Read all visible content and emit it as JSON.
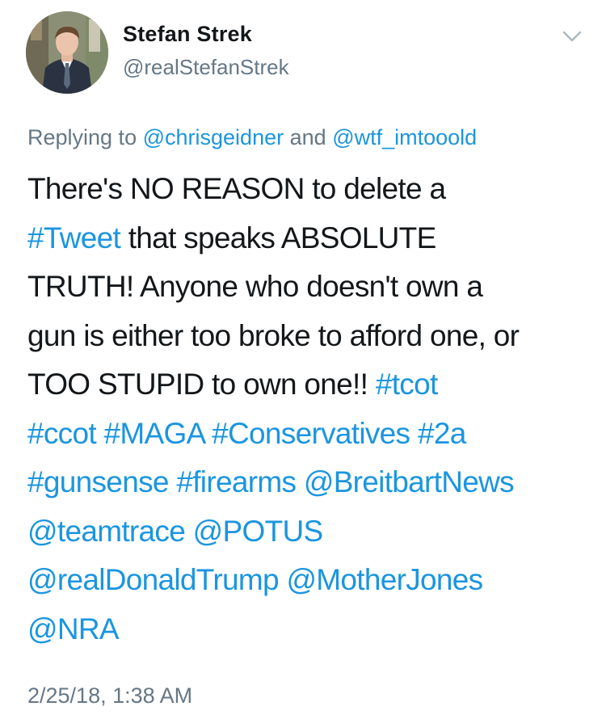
{
  "header": {
    "display_name": "Stefan Strek",
    "handle": "@realStefanStrek"
  },
  "icons": {
    "avatar": "profile-photo",
    "menu": "chevron-down-icon"
  },
  "colors": {
    "link": "#1b95e0",
    "secondary": "#657786",
    "text": "#14171a"
  },
  "reply": {
    "prefix": "Replying to",
    "mention1": "@chrisgeidner",
    "joiner": "and",
    "mention2": "@wtf_imtooold"
  },
  "tweet": {
    "l1": "There's NO REASON to delete a",
    "l2_tag": "#Tweet",
    "l2_text": "that speaks ABSOLUTE",
    "l3": "TRUTH! Anyone who doesn't own a",
    "l4": "gun is either too broke to afford one, or",
    "l5_text": "TOO STUPID to own one!!",
    "l5_tag": "#tcot",
    "l6_tag1": "#ccot",
    "l6_tag2": "#MAGA",
    "l6_tag3": "#Conservatives",
    "l6_tag4": "#2a",
    "l7_tag1": "#gunsense",
    "l7_tag2": "#firearms",
    "l7_mention": "@BreitbartNews",
    "l8_mention1": "@teamtrace",
    "l8_mention2": "@POTUS",
    "l9_mention1": "@realDonaldTrump",
    "l9_mention2": "@MotherJones",
    "l10_mention": "@NRA"
  },
  "timestamp": "2/25/18, 1:38 AM"
}
